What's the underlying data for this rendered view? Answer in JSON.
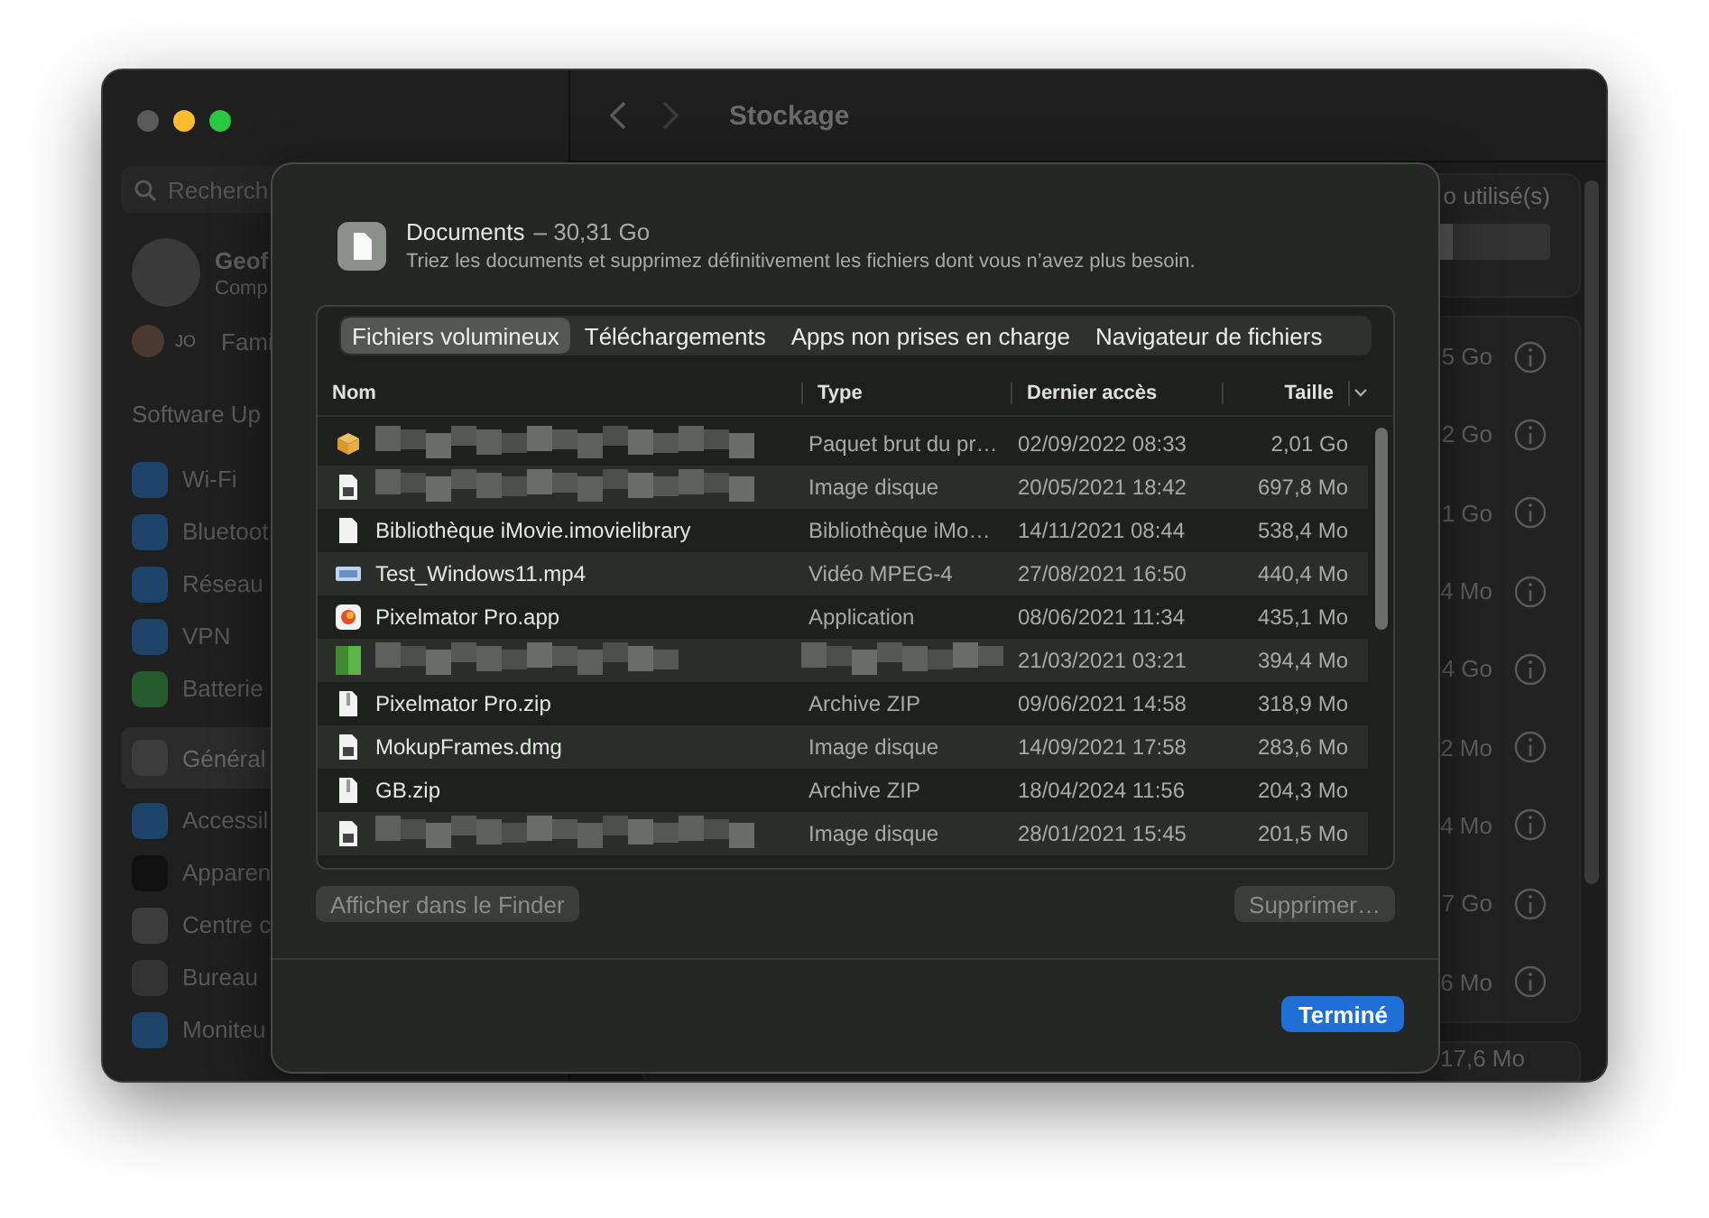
{
  "window": {
    "title": "Stockage"
  },
  "sidebar": {
    "search": {
      "placeholder": "Recherch"
    },
    "account": {
      "name": "Geof",
      "subtitle": "Comp"
    },
    "family": {
      "initials": "JO",
      "label": "Fami"
    },
    "section": "Software Up",
    "items": [
      {
        "label": "Wi-Fi",
        "color": "#1d4468",
        "selected": false
      },
      {
        "label": "Bluetoot",
        "color": "#1d4468",
        "selected": false
      },
      {
        "label": "Réseau",
        "color": "#1d4468",
        "selected": false
      },
      {
        "label": "VPN",
        "color": "#1d4468",
        "selected": false
      },
      {
        "label": "Batterie",
        "color": "#255a2c",
        "selected": false
      },
      {
        "label": "Général",
        "color": "#3c3c3c",
        "selected": true
      },
      {
        "label": "Accessil",
        "color": "#1d4468",
        "selected": false
      },
      {
        "label": "Apparen",
        "color": "#101010",
        "selected": false
      },
      {
        "label": "Centre c",
        "color": "#3c3c3c",
        "selected": false
      },
      {
        "label": "Bureau",
        "color": "#333333",
        "selected": false
      },
      {
        "label": "Moniteu",
        "color": "#1d4468",
        "selected": false
      }
    ]
  },
  "storage": {
    "summary": "o utilisé(s)",
    "sizes": [
      "5 Go",
      "2 Go",
      "1 Go",
      "4 Mo",
      "4 Go",
      "2 Mo",
      "4 Mo",
      "7 Go",
      "6 Mo"
    ],
    "other_size": "17,6 Mo"
  },
  "sheet": {
    "title": "Documents",
    "size": "– 30,31 Go",
    "description": "Triez les documents et supprimez définitivement les fichiers dont vous n’avez plus besoin.",
    "tabs": [
      {
        "label": "Fichiers volumineux",
        "selected": true
      },
      {
        "label": "Téléchargements",
        "selected": false
      },
      {
        "label": "Apps non prises en charge",
        "selected": false
      },
      {
        "label": "Navigateur de fichiers",
        "selected": false
      }
    ],
    "columns": [
      "Nom",
      "Type",
      "Dernier accès",
      "Taille"
    ],
    "rows": [
      {
        "kind": "package",
        "name_redacted": true,
        "type": "Paquet brut du pr…",
        "accessed": "02/09/2022 08:33",
        "size": "2,01 Go"
      },
      {
        "kind": "disk",
        "name_redacted": true,
        "type": "Image disque",
        "accessed": "20/05/2021 18:42",
        "size": "697,8 Mo"
      },
      {
        "kind": "document",
        "name": "Bibliothèque iMovie.imovielibrary",
        "type": "Bibliothèque iMo…",
        "accessed": "14/11/2021 08:44",
        "size": "538,4 Mo"
      },
      {
        "kind": "video",
        "name": "Test_Windows11.mp4",
        "type": "Vidéo MPEG-4",
        "accessed": "27/08/2021 16:50",
        "size": "440,4 Mo"
      },
      {
        "kind": "app",
        "name": "Pixelmator Pro.app",
        "type": "Application",
        "accessed": "08/06/2021 11:34",
        "size": "435,1 Mo"
      },
      {
        "kind": "image",
        "name_redacted": true,
        "type_redacted": true,
        "accessed": "21/03/2021 03:21",
        "size": "394,4 Mo"
      },
      {
        "kind": "zip",
        "name": "Pixelmator Pro.zip",
        "type": "Archive ZIP",
        "accessed": "09/06/2021 14:58",
        "size": "318,9 Mo"
      },
      {
        "kind": "disk",
        "name": "MokupFrames.dmg",
        "type": "Image disque",
        "accessed": "14/09/2021 17:58",
        "size": "283,6 Mo"
      },
      {
        "kind": "zip",
        "name": "GB.zip",
        "type": "Archive ZIP",
        "accessed": "18/04/2024 11:56",
        "size": "204,3 Mo"
      },
      {
        "kind": "disk",
        "name_redacted": true,
        "type": "Image disque",
        "accessed": "28/01/2021 15:45",
        "size": "201,5 Mo"
      }
    ],
    "buttons": [
      {
        "label": "Afficher dans le Finder",
        "disabled": true
      },
      {
        "label": "Supprimer…",
        "disabled": true
      }
    ],
    "done": {
      "label": "Terminé"
    }
  }
}
